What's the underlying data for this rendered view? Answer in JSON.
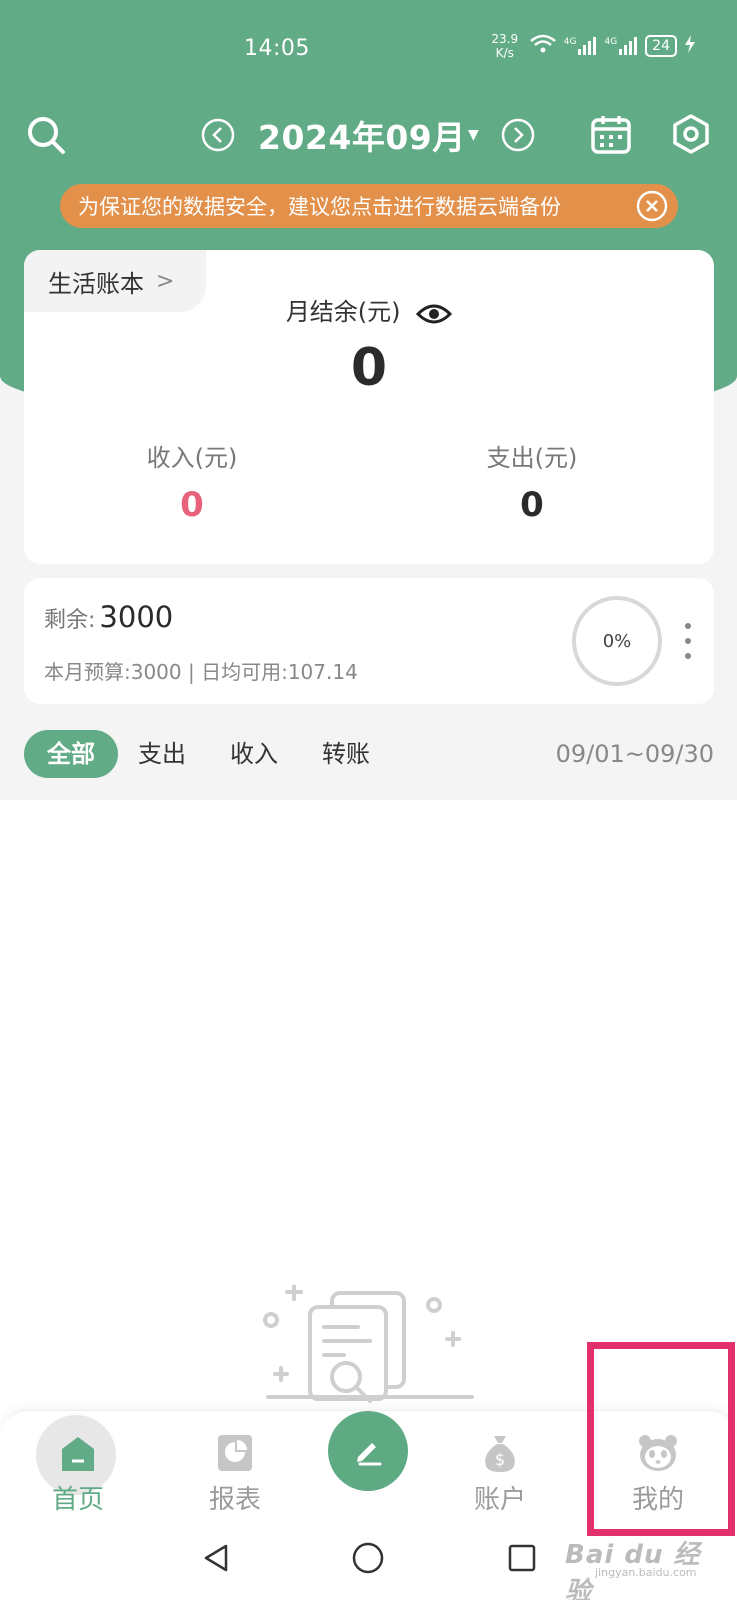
{
  "status_bar": {
    "time": "14:05",
    "net_speed_value": "23.9",
    "net_speed_unit": "K/s",
    "network_1": "4G",
    "network_2": "4G",
    "battery": "24"
  },
  "header": {
    "month_title": "2024年09月",
    "icons": [
      "search-icon",
      "prev-month-icon",
      "dropdown-caret-icon",
      "next-month-icon",
      "calendar-icon",
      "settings-icon"
    ]
  },
  "banner": {
    "text": "为保证您的数据安全，建议您点击进行数据云端备份"
  },
  "summary": {
    "book_name": "生活账本",
    "balance_label": "月结余(元)",
    "balance_value": "0",
    "income_label": "收入(元)",
    "income_value": "0",
    "expense_label": "支出(元)",
    "expense_value": "0"
  },
  "budget": {
    "remain_label": "剩余:",
    "remain_value": "3000",
    "detail": "本月预算:3000 | 日均可用:107.14",
    "percent_label": "0%",
    "percent_used": 0
  },
  "filters": {
    "tabs": [
      "全部",
      "支出",
      "收入",
      "转账"
    ],
    "active": "全部",
    "date_range": "09/01~09/30"
  },
  "bottom_nav": {
    "items": [
      {
        "label": "首页",
        "icon": "home-icon",
        "active": true
      },
      {
        "label": "报表",
        "icon": "report-icon",
        "active": false
      },
      {
        "label": "",
        "icon": "pencil-icon",
        "active": false
      },
      {
        "label": "账户",
        "icon": "money-bag-icon",
        "active": false
      },
      {
        "label": "我的",
        "icon": "panda-icon",
        "active": false
      }
    ]
  },
  "colors": {
    "primary": "#62ab87",
    "banner": "#e3904a",
    "income": "#e8627b",
    "highlight": "#e1306c"
  },
  "watermark": {
    "main": "Bai du 经验",
    "sub": "jingyan.baidu.com"
  }
}
